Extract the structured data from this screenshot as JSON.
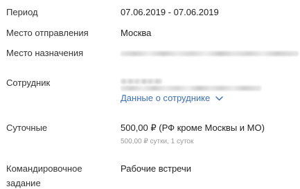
{
  "rows": {
    "period": {
      "label": "Период",
      "value": "07.06.2019 - 07.06.2019"
    },
    "departure": {
      "label": "Место отправления",
      "value": "Москва"
    },
    "destination": {
      "label": "Место назначения"
    },
    "employee": {
      "label": "Сотрудник",
      "details_link": "Данные о сотруднике"
    },
    "per_diem": {
      "label": "Суточные",
      "value": "500,00 ₽ (РФ кроме Москвы и МО)",
      "detail": "500,00 ₽ сутки, 1 суток"
    },
    "assignment": {
      "label_line1": "Командировочное",
      "label_line2": "задание",
      "value": "Рабочие встречи"
    }
  },
  "colors": {
    "link": "#3d6fb6",
    "muted": "#9a9a9a",
    "text": "#222222"
  },
  "icons": {
    "details_toggle": "chevron-down-icon"
  }
}
